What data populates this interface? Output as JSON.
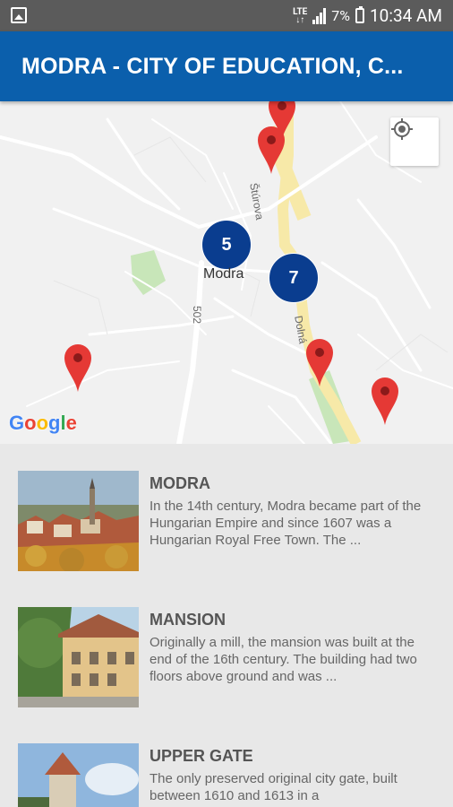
{
  "status_bar": {
    "network": "LTE",
    "battery": "7%",
    "time": "10:34 AM"
  },
  "app_bar": {
    "title": "MODRA - CITY OF EDUCATION, C..."
  },
  "map": {
    "town_label": "Modra",
    "street_labels": [
      "Štúrova",
      "Dolná",
      "502"
    ],
    "clusters": [
      "5",
      "7"
    ],
    "attribution": "Google",
    "location_button_icon": "crosshair-icon"
  },
  "items": [
    {
      "title": "MODRA",
      "description": "In the 14th century, Modra became part of the Hungarian Empire and since 1607 was a Hungarian Royal Free Town. The ..."
    },
    {
      "title": "MANSION",
      "description": "Originally a mill, the mansion was built at the end of the 16th century. The building had two floors above ground and was ..."
    },
    {
      "title": "UPPER GATE",
      "description": "The only preserved original city gate, built between 1610 and 1613 in a"
    }
  ],
  "colors": {
    "app_bar": "#0b5fac",
    "status_bar": "#5b5b5b",
    "cluster": "#0a3d8f",
    "pin": "#e53935"
  }
}
